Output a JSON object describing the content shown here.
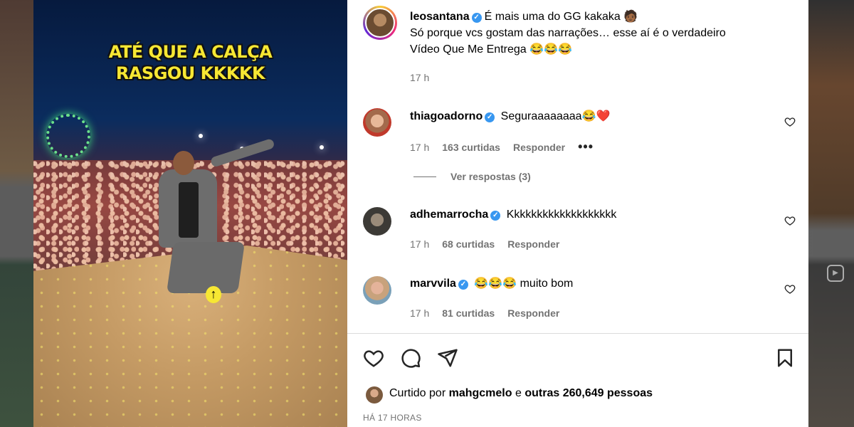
{
  "video": {
    "caption": "ATÉ QUE A CALÇA\nRASGOU KKKKK",
    "overlay_icon": "arrow-up-icon"
  },
  "post": {
    "author": "leosantana",
    "text_line1": "É mais uma do GG kakaka 🧑🏾",
    "text_line2": "Só porque vcs gostam das narrações… esse aí é o verdadeiro",
    "text_line3": "Vídeo Que Me Entrega 😂😂😂",
    "time": "17 h"
  },
  "comments": [
    {
      "username": "thiagoadorno",
      "text": "Seguraaaaaaaa😂❤️",
      "time": "17 h",
      "likes": "163 curtidas",
      "reply": "Responder",
      "more": "•••"
    },
    {
      "username": "adhemarrocha",
      "text": "Kkkkkkkkkkkkkkkkkkk",
      "time": "17 h",
      "likes": "68 curtidas",
      "reply": "Responder"
    },
    {
      "username": "marvvila",
      "text": "😂😂😂 muito bom",
      "time": "17 h",
      "likes": "81 curtidas",
      "reply": "Responder"
    }
  ],
  "replies_toggle": "Ver respostas (3)",
  "likes": {
    "prefix": "Curtido por",
    "user": "mahgcmelo",
    "conj": "e",
    "others": "outras 260,649 pessoas"
  },
  "post_age": "HÁ 17 HORAS",
  "icons": {
    "verified": "verified-badge-icon",
    "like": "heart-icon",
    "comment": "comment-icon",
    "share": "share-icon",
    "save": "bookmark-icon",
    "reels": "reels-icon"
  },
  "colors": {
    "verified": "#3897f0",
    "caption_yellow": "#f7e733",
    "muted": "#737373"
  }
}
